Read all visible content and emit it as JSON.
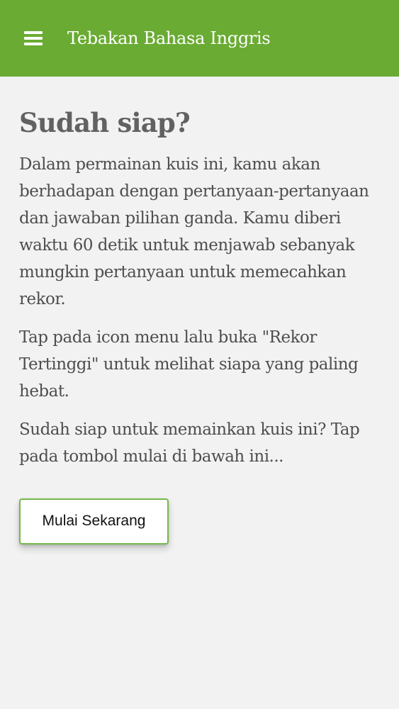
{
  "app_bar": {
    "menu_icon": "menu-icon",
    "title": "Tebakan Bahasa Inggris"
  },
  "main": {
    "heading": "Sudah siap?",
    "paragraphs": [
      "Dalam permainan kuis ini, kamu akan berhadapan dengan pertanyaan-pertanyaan dan jawaban pilihan ganda. Kamu diberi waktu 60 detik untuk menjawab sebanyak mungkin pertanyaan untuk memecahkan rekor.",
      "Tap pada icon menu lalu buka \"Rekor Tertinggi\" untuk melihat siapa yang paling hebat.",
      "Sudah siap untuk memainkan kuis ini? Tap pada tombol mulai di bawah ini..."
    ],
    "start_button_label": "Mulai Sekarang"
  },
  "colors": {
    "app_bar": "#6aab33",
    "button_border": "#76b84a",
    "background": "#f2f2f2",
    "heading": "#616161",
    "body_text": "#4e4e4e"
  }
}
